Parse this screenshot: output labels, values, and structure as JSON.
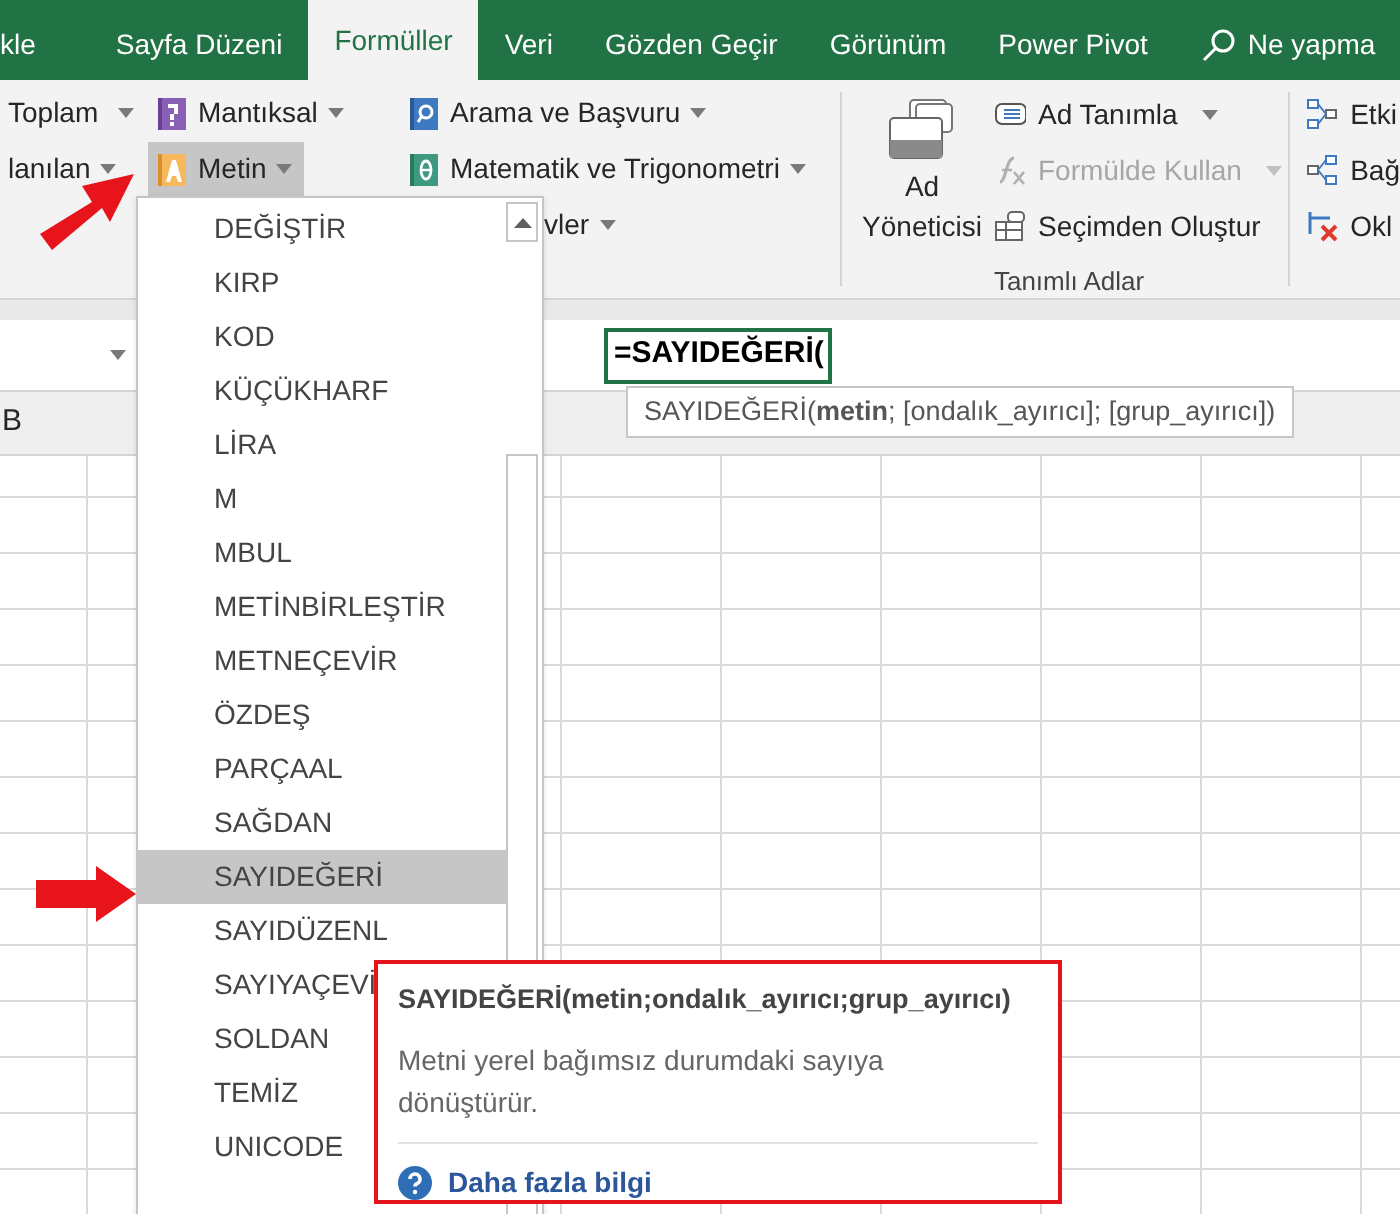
{
  "tabs": [
    {
      "label": "kle",
      "selected": false
    },
    {
      "label": "Sayfa Düzeni",
      "selected": false
    },
    {
      "label": "Formüller",
      "selected": true
    },
    {
      "label": "Veri",
      "selected": false
    },
    {
      "label": "Gözden Geçir",
      "selected": false
    },
    {
      "label": "Görünüm",
      "selected": false
    },
    {
      "label": "Power Pivot",
      "selected": false
    }
  ],
  "tell_me": {
    "placeholder": "Ne yapma"
  },
  "function_library": {
    "columns": [
      [
        {
          "label": "Toplam",
          "kind": "plain",
          "expanded": false
        },
        {
          "label": "lanılan",
          "kind": "plain",
          "expanded": false
        }
      ],
      [
        {
          "label": "Mantıksal",
          "kind": "logical",
          "expanded": false
        },
        {
          "label": "Metin",
          "kind": "text",
          "expanded": true
        }
      ],
      [
        {
          "label": "Arama ve Başvuru",
          "kind": "lookup",
          "expanded": false
        },
        {
          "label": "Matematik ve Trigonometri",
          "kind": "math",
          "expanded": false
        },
        {
          "label": "vler",
          "kind": "plain",
          "expanded": false
        }
      ]
    ]
  },
  "defined_names": {
    "manager": "Ad Yöneticisi",
    "commands": [
      {
        "label": "Ad Tanımla",
        "kind": "define",
        "dropdown": true,
        "disabled": false
      },
      {
        "label": "Formülde Kullan",
        "kind": "use",
        "dropdown": true,
        "disabled": true
      },
      {
        "label": "Seçimden Oluştur",
        "kind": "create",
        "dropdown": false,
        "disabled": false
      }
    ],
    "group_label": "Tanımlı Adlar"
  },
  "formula_auditing": {
    "commands": [
      {
        "label": "Etki",
        "kind": "precedents"
      },
      {
        "label": "Bağ",
        "kind": "dependents"
      },
      {
        "label": "Okl",
        "kind": "remove"
      }
    ]
  },
  "cell_editor": {
    "value": "=SAYIDEĞERİ("
  },
  "syntax_hint": "SAYIDEĞERİ(**metin**; [ondalık_ayırıcı]; [grup_ayırıcı])",
  "column_headers": [
    "B"
  ],
  "function_menu": {
    "items": [
      {
        "label": "DEĞİŞTİR",
        "selected": false
      },
      {
        "label": "KIRP",
        "selected": false
      },
      {
        "label": "KOD",
        "selected": false
      },
      {
        "label": "KÜÇÜKHARF",
        "selected": false
      },
      {
        "label": "LİRA",
        "selected": false
      },
      {
        "label": "M",
        "selected": false
      },
      {
        "label": "MBUL",
        "selected": false
      },
      {
        "label": "METİNBİRLEŞTİR",
        "selected": false
      },
      {
        "label": "METNEÇEVİR",
        "selected": false
      },
      {
        "label": "ÖZDEŞ",
        "selected": false
      },
      {
        "label": "PARÇAAL",
        "selected": false
      },
      {
        "label": "SAĞDAN",
        "selected": false
      },
      {
        "label": "SAYIDEĞERİ",
        "selected": true
      },
      {
        "label": "SAYIDÜZENL",
        "selected": false
      },
      {
        "label": "SAYIYAÇEVİ",
        "selected": false
      },
      {
        "label": "SOLDAN",
        "selected": false
      },
      {
        "label": "TEMİZ",
        "selected": false
      },
      {
        "label": "UNICODE",
        "selected": false
      }
    ]
  },
  "tooltip": {
    "title": "SAYIDEĞERİ(metin;ondalık_ayırıcı;grup_ayırıcı)",
    "description": "Metni yerel bağımsız durumdaki sayıya dönüştürür.",
    "link": "Daha fazla bilgi"
  }
}
